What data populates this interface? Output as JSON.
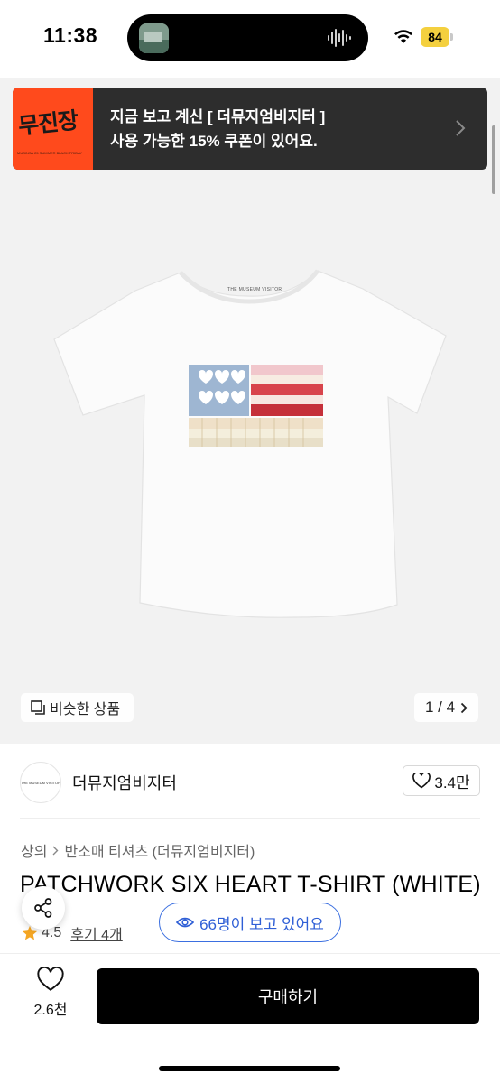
{
  "status_bar": {
    "time": "11:38",
    "battery": "84"
  },
  "banner": {
    "logo_text": "무진장",
    "logo_subtext": "MUSINSA  25 SUMMER BLACK FRIDAY",
    "line1": "지금 보고 계신 [ 더뮤지엄비지터 ]",
    "line2": "사용 가능한 15% 쿠폰이 있어요."
  },
  "gallery": {
    "similar_label": "비슷한 상품",
    "pager": "1 / 4",
    "tee_label": "THE MUSEUM VISITOR"
  },
  "brand": {
    "avatar_text": "THE MUSEUM VISITOR",
    "name": "더뮤지엄비지터",
    "likes": "3.4만"
  },
  "breadcrumb": {
    "level1": "상의",
    "level2": "반소매 티셔츠 (더뮤지엄비지터)"
  },
  "product": {
    "title": "PATCHWORK SIX HEART T-SHIRT (WHITE)",
    "rating": "4.5",
    "reviews": "후기 4개"
  },
  "viewers": {
    "label": "66명이 보고 있어요"
  },
  "bottom_bar": {
    "wish_count": "2.6천",
    "buy_label": "구매하기"
  },
  "colors": {
    "accent_blue": "#2f5fd6",
    "banner_orange": "#ff4a1c",
    "star": "#f5a623",
    "battery": "#f4d03f"
  }
}
